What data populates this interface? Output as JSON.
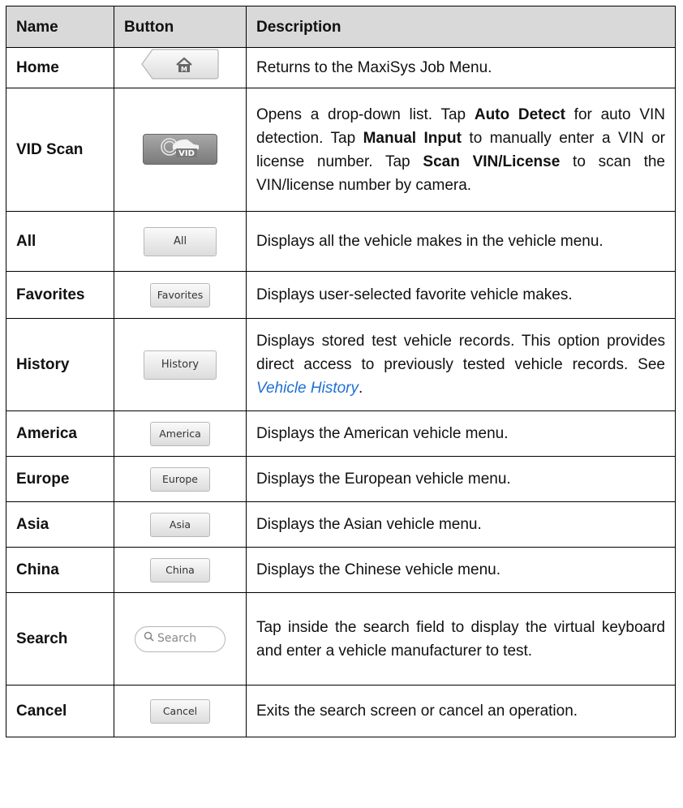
{
  "headers": {
    "name": "Name",
    "button": "Button",
    "description": "Description"
  },
  "rows": [
    {
      "name": "Home",
      "button_icon": "home-icon",
      "desc": [
        "Returns to the MaxiSys Job Menu."
      ]
    },
    {
      "name": "VID Scan",
      "button_label": "VID",
      "button_icon": "car-vid-icon",
      "desc": [
        "Opens a drop-down list. Tap ",
        "Auto Detect",
        " for auto VIN detection. Tap ",
        "Manual Input",
        " to manually enter a VIN or license number. Tap ",
        "Scan VIN/License",
        " to scan the VIN/license number by camera."
      ]
    },
    {
      "name": "All",
      "button_label": "All",
      "desc": [
        "Displays all the vehicle makes in the vehicle menu."
      ]
    },
    {
      "name": "Favorites",
      "button_label": "Favorites",
      "desc": [
        "Displays user-selected favorite vehicle makes."
      ]
    },
    {
      "name": "History",
      "button_label": "History",
      "desc": [
        "Displays stored test vehicle records. This option provides direct access to previously tested vehicle records. See ",
        "Vehicle History",
        "."
      ]
    },
    {
      "name": "America",
      "button_label": "America",
      "desc": [
        "Displays the American vehicle menu."
      ]
    },
    {
      "name": "Europe",
      "button_label": "Europe",
      "desc": [
        "Displays the European vehicle menu."
      ]
    },
    {
      "name": "Asia",
      "button_label": "Asia",
      "desc": [
        "Displays the Asian vehicle menu."
      ]
    },
    {
      "name": "China",
      "button_label": "China",
      "desc": [
        "Displays the Chinese vehicle menu."
      ]
    },
    {
      "name": "Search",
      "button_label": "Search",
      "button_icon": "search-icon",
      "desc": [
        "Tap inside the search field to display the virtual keyboard and enter a vehicle manufacturer to test."
      ]
    },
    {
      "name": "Cancel",
      "button_label": "Cancel",
      "desc": [
        "Exits the search screen or cancel an operation."
      ]
    }
  ],
  "colors": {
    "header_bg": "#d9d9d9",
    "link": "#1f6fd6"
  }
}
